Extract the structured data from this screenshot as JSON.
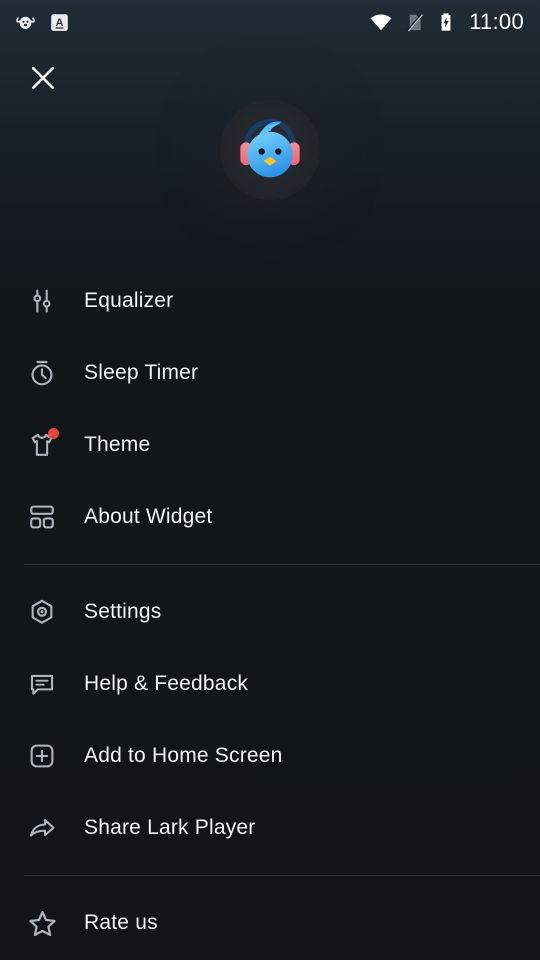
{
  "status_bar": {
    "left_icons": [
      {
        "name": "app-notification-icon",
        "label": "Lark player notification"
      },
      {
        "name": "letter-a-icon",
        "label": "A"
      }
    ],
    "right_icons": [
      {
        "name": "wifi-icon",
        "label": "Wi-Fi"
      },
      {
        "name": "no-sim-icon",
        "label": "No SIM"
      },
      {
        "name": "battery-charging-icon",
        "label": "Battery charging"
      }
    ],
    "clock": "11:00"
  },
  "header": {
    "close_label": "Close",
    "avatar_name": "Lark Player bird logo"
  },
  "colors": {
    "accent_red": "#e8453c",
    "bird_blue": "#52b6f5",
    "headphone_pink": "#f8707f",
    "beak_yellow": "#ffc61e",
    "divider": "#2b3238",
    "text": "#f2f4f6"
  },
  "menu": {
    "groups": [
      {
        "items": [
          {
            "label": "Equalizer",
            "icon": "equalizer-icon",
            "badge": false
          },
          {
            "label": "Sleep Timer",
            "icon": "sleep-timer-icon",
            "badge": false
          },
          {
            "label": "Theme",
            "icon": "theme-shirt-icon",
            "badge": true
          },
          {
            "label": "About Widget",
            "icon": "widget-layout-icon",
            "badge": false
          }
        ]
      },
      {
        "items": [
          {
            "label": "Settings",
            "icon": "settings-gear-icon",
            "badge": false
          },
          {
            "label": "Help & Feedback",
            "icon": "help-chat-icon",
            "badge": false
          },
          {
            "label": "Add to Home Screen",
            "icon": "add-home-screen-icon",
            "badge": false
          },
          {
            "label": "Share Lark Player",
            "icon": "share-arrow-icon",
            "badge": false
          }
        ]
      },
      {
        "items": [
          {
            "label": "Rate us",
            "icon": "star-rate-icon",
            "badge": false
          }
        ]
      }
    ]
  }
}
